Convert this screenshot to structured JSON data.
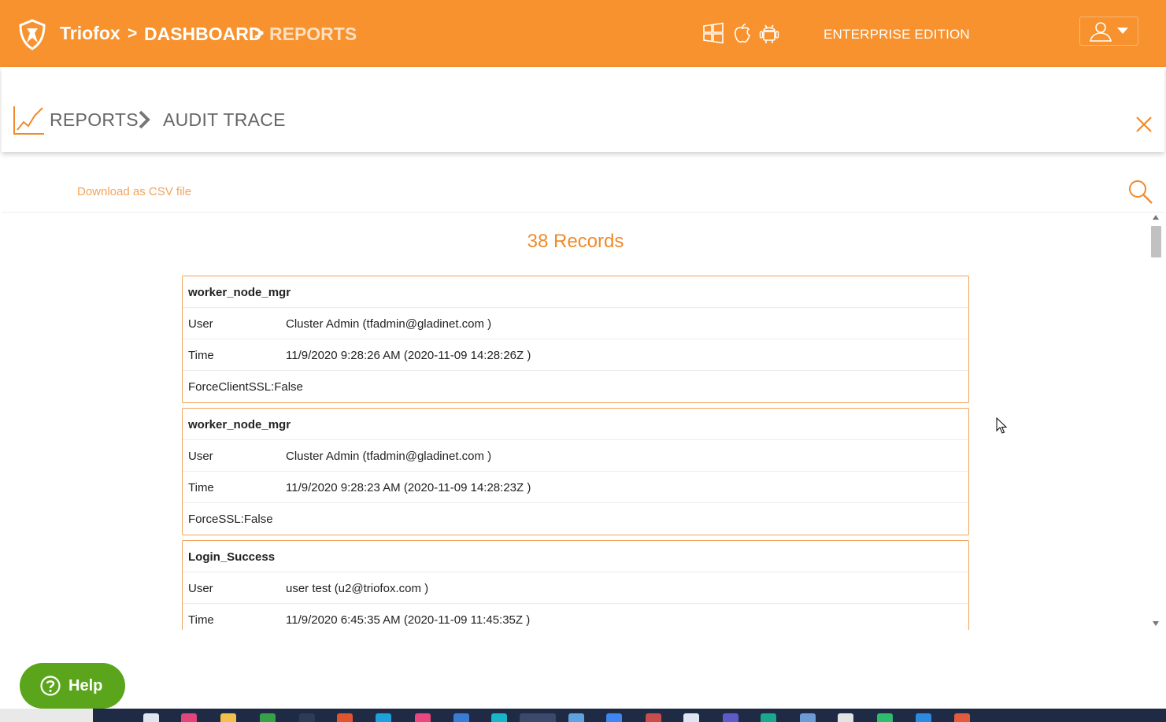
{
  "header": {
    "brand": "Triofox",
    "breadcrumb": [
      {
        "sep": ">",
        "label": "DASHBOARD"
      },
      {
        "sep": ">",
        "label": "REPORTS"
      }
    ],
    "edition": "ENTERPRISE EDITION",
    "os_icons": [
      "windows-icon",
      "apple-icon",
      "android-icon"
    ],
    "user_menu_icon": "user-icon"
  },
  "subheader": {
    "section": "REPORTS",
    "page": "AUDIT TRACE"
  },
  "toolbar": {
    "download_label": "Download as CSV file"
  },
  "records_count": "38 Records",
  "records": [
    {
      "title": "worker_node_mgr",
      "user_label": "User",
      "user": "Cluster Admin (tfadmin@gladinet.com )",
      "time_label": "Time",
      "time": "11/9/2020 9:28:26 AM (2020-11-09 14:28:26Z )",
      "detail": "ForceClientSSL:False"
    },
    {
      "title": "worker_node_mgr",
      "user_label": "User",
      "user": "Cluster Admin (tfadmin@gladinet.com )",
      "time_label": "Time",
      "time": "11/9/2020 9:28:23 AM (2020-11-09 14:28:23Z )",
      "detail": "ForceSSL:False"
    },
    {
      "title": "Login_Success",
      "user_label": "User",
      "user": "user test (u2@triofox.com )",
      "time_label": "Time",
      "time": "11/9/2020 6:45:35 AM (2020-11-09 11:45:35Z )",
      "detail": ""
    }
  ],
  "help": {
    "label": "Help"
  },
  "colors": {
    "brand_orange": "#f7922e",
    "accent_orange": "#f08a2a",
    "help_green": "#5aa51c"
  }
}
